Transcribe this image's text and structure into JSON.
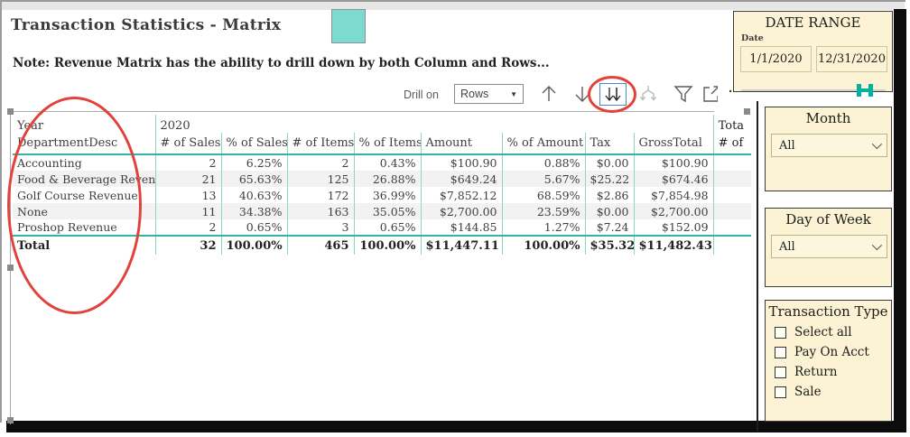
{
  "header": {
    "title": "Transaction Statistics - Matrix",
    "note": "Note: Revenue Matrix has the ability to drill down by both Column and Rows..."
  },
  "toolbar": {
    "drill_on_label": "Drill on",
    "drill_on_value": "Rows",
    "dropdown_arrow_glyph": "▼",
    "more_options_glyph": "···"
  },
  "matrix": {
    "row_header_top": "Year",
    "row_header_bottom": "DepartmentDesc",
    "group_header": "2020",
    "total_header": {
      "line1": "Tota",
      "line2": "# of"
    },
    "columns": [
      "# of Sales",
      "% of Sales",
      "# of Items",
      "% of Items",
      "Amount",
      "% of Amount",
      "Tax",
      "GrossTotal"
    ],
    "rows": [
      {
        "dept": "Accounting",
        "values": [
          "2",
          "6.25%",
          "2",
          "0.43%",
          "$100.90",
          "0.88%",
          "$0.00",
          "$100.90"
        ]
      },
      {
        "dept": "Food & Beverage Revenue",
        "values": [
          "21",
          "65.63%",
          "125",
          "26.88%",
          "$649.24",
          "5.67%",
          "$25.22",
          "$674.46"
        ]
      },
      {
        "dept": "Golf Course Revenue",
        "values": [
          "13",
          "40.63%",
          "172",
          "36.99%",
          "$7,852.12",
          "68.59%",
          "$2.86",
          "$7,854.98"
        ]
      },
      {
        "dept": "None",
        "values": [
          "11",
          "34.38%",
          "163",
          "35.05%",
          "$2,700.00",
          "23.59%",
          "$0.00",
          "$2,700.00"
        ]
      },
      {
        "dept": "Proshop Revenue",
        "values": [
          "2",
          "0.65%",
          "3",
          "0.65%",
          "$144.85",
          "1.27%",
          "$7.24",
          "$152.09"
        ]
      }
    ],
    "total": {
      "dept": "Total",
      "values": [
        "32",
        "100.00%",
        "465",
        "100.00%",
        "$11,447.11",
        "100.00%",
        "$35.32",
        "$11,482.43"
      ]
    }
  },
  "filters": {
    "date_range": {
      "title": "DATE RANGE",
      "label": "Date",
      "start": "1/1/2020",
      "end": "12/31/2020"
    },
    "month": {
      "title": "Month",
      "value": "All"
    },
    "day_of_week": {
      "title": "Day of Week",
      "value": "All"
    },
    "transaction_type": {
      "title": "Transaction Type",
      "options": [
        "Select all",
        "Pay On Acct",
        "Return",
        "Sale"
      ]
    }
  },
  "colors": {
    "accent_teal": "#7cdace",
    "matrix_line_teal": "#33b2a6",
    "annotation_red": "#e2423c",
    "panel_cream": "#fbf3d3",
    "slider_teal": "#00b2a4"
  }
}
